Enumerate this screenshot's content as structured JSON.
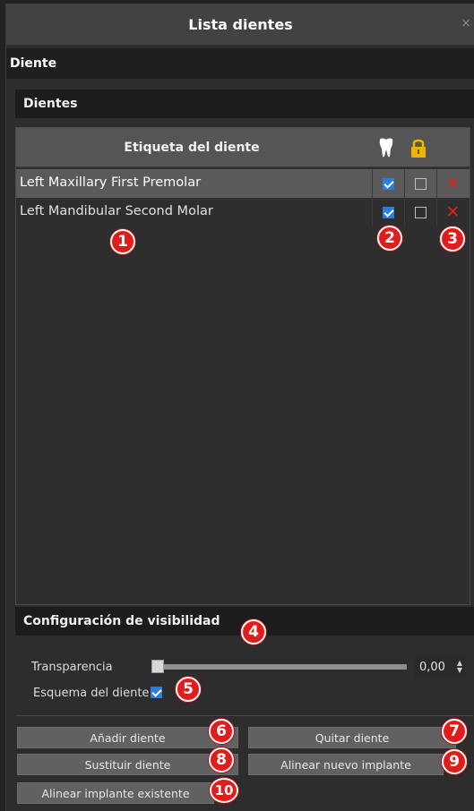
{
  "window": {
    "title": "Lista dientes",
    "close_glyph": "×"
  },
  "section": {
    "title": "Diente"
  },
  "teeth_group": {
    "title": "Dientes",
    "column_label": "Etiqueta del diente",
    "visible_icon": "tooth-icon",
    "lock_icon": "lock-icon",
    "rows": [
      {
        "label": "Left Maxillary First Premolar",
        "visible": true,
        "locked": false,
        "selected": true
      },
      {
        "label": "Left Mandibular Second Molar",
        "visible": true,
        "locked": false,
        "selected": false
      }
    ]
  },
  "visibility": {
    "title": "Configuración de visibilidad",
    "transparency_label": "Transparencia",
    "transparency_value": "0,00",
    "transparency_level": 0,
    "outline_label": "Esquema del diente",
    "outline_checked": true
  },
  "buttons": {
    "add": "Añadir diente",
    "remove": "Quitar diente",
    "replace": "Sustituir diente",
    "align_new": "Alinear nuevo implante",
    "align_existing": "Alinear implante existente"
  },
  "callouts": [
    "1",
    "2",
    "3",
    "4",
    "5",
    "6",
    "7",
    "8",
    "9",
    "10"
  ],
  "colors": {
    "badge": "#e21b1b",
    "checkbox_on": "#2b7de0",
    "delete": "#e02020",
    "lock": "#f0b400"
  }
}
